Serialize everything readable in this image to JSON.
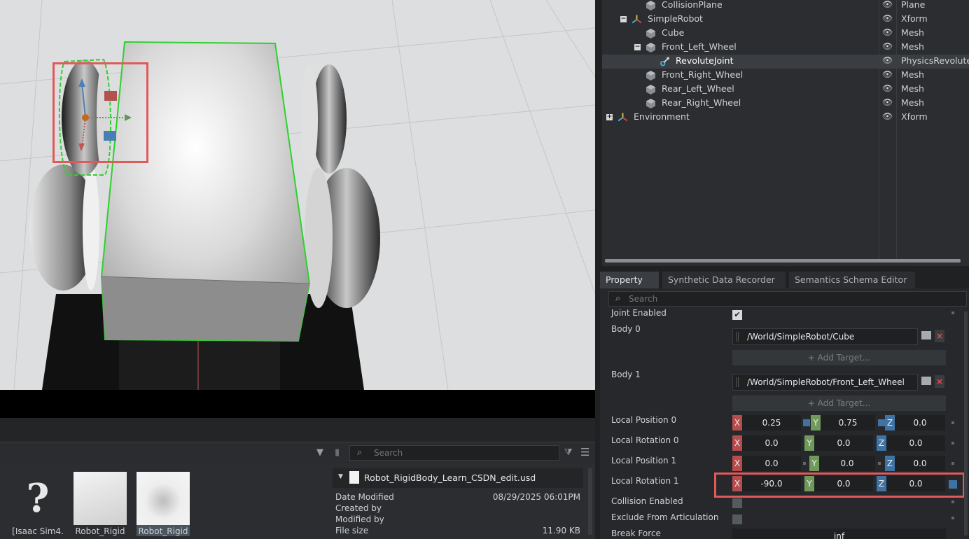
{
  "stage_tree": {
    "rows": [
      {
        "label": "CollisionPlane",
        "type": "Plane"
      },
      {
        "label": "SimpleRobot",
        "type": "Xform"
      },
      {
        "label": "Cube",
        "type": "Mesh"
      },
      {
        "label": "Front_Left_Wheel",
        "type": "Mesh"
      },
      {
        "label": "RevoluteJoint",
        "type": "PhysicsRevolute"
      },
      {
        "label": "Front_Right_Wheel",
        "type": "Mesh"
      },
      {
        "label": "Rear_Left_Wheel",
        "type": "Mesh"
      },
      {
        "label": "Rear_Right_Wheel",
        "type": "Mesh"
      },
      {
        "label": "Environment",
        "type": "Xform"
      }
    ]
  },
  "property_panel": {
    "tabs": [
      "Property",
      "Synthetic Data Recorder",
      "Semantics Schema Editor"
    ],
    "search_placeholder": "Search",
    "joint_enabled_label": "Joint Enabled",
    "body0_label": "Body 0",
    "body0_path": "/World/SimpleRobot/Cube",
    "body1_label": "Body 1",
    "body1_path": "/World/SimpleRobot/Front_Left_Wheel",
    "add_target": "Add Target...",
    "local_position_0": {
      "label": "Local Position 0",
      "x": "0.25",
      "y": "0.75",
      "z": "0.0"
    },
    "local_rotation_0": {
      "label": "Local Rotation 0",
      "x": "0.0",
      "y": "0.0",
      "z": "0.0"
    },
    "local_position_1": {
      "label": "Local Position 1",
      "x": "0.0",
      "y": "0.0",
      "z": "0.0"
    },
    "local_rotation_1": {
      "label": "Local Rotation 1",
      "x": "-90.0",
      "y": "0.0",
      "z": "0.0"
    },
    "collision_enabled_label": "Collision Enabled",
    "exclude_articulation_label": "Exclude From Articulation",
    "break_force_label": "Break Force",
    "break_force_value": "inf",
    "axis_labels": {
      "x": "X",
      "y": "Y",
      "z": "Z"
    }
  },
  "content_browser": {
    "search_placeholder": "Search",
    "thumbnails": [
      {
        "caption": "[Isaac Sim4."
      },
      {
        "caption": "Robot_Rigid"
      },
      {
        "caption": "Robot_Rigid"
      }
    ],
    "file_info": {
      "filename": "Robot_RigidBody_Learn_CSDN_edit.usd",
      "date_modified_label": "Date Modified",
      "date_modified": "08/29/2025 06:01PM",
      "created_by_label": "Created by",
      "modified_by_label": "Modified by",
      "file_size_label": "File size",
      "file_size": "11.90 KB"
    }
  },
  "colors": {
    "highlight": "#e05a5a",
    "axis_x": "#b84b4b",
    "axis_y": "#6f9a5c",
    "axis_z": "#3f73a3",
    "selection_outline": "#2fd02f"
  }
}
